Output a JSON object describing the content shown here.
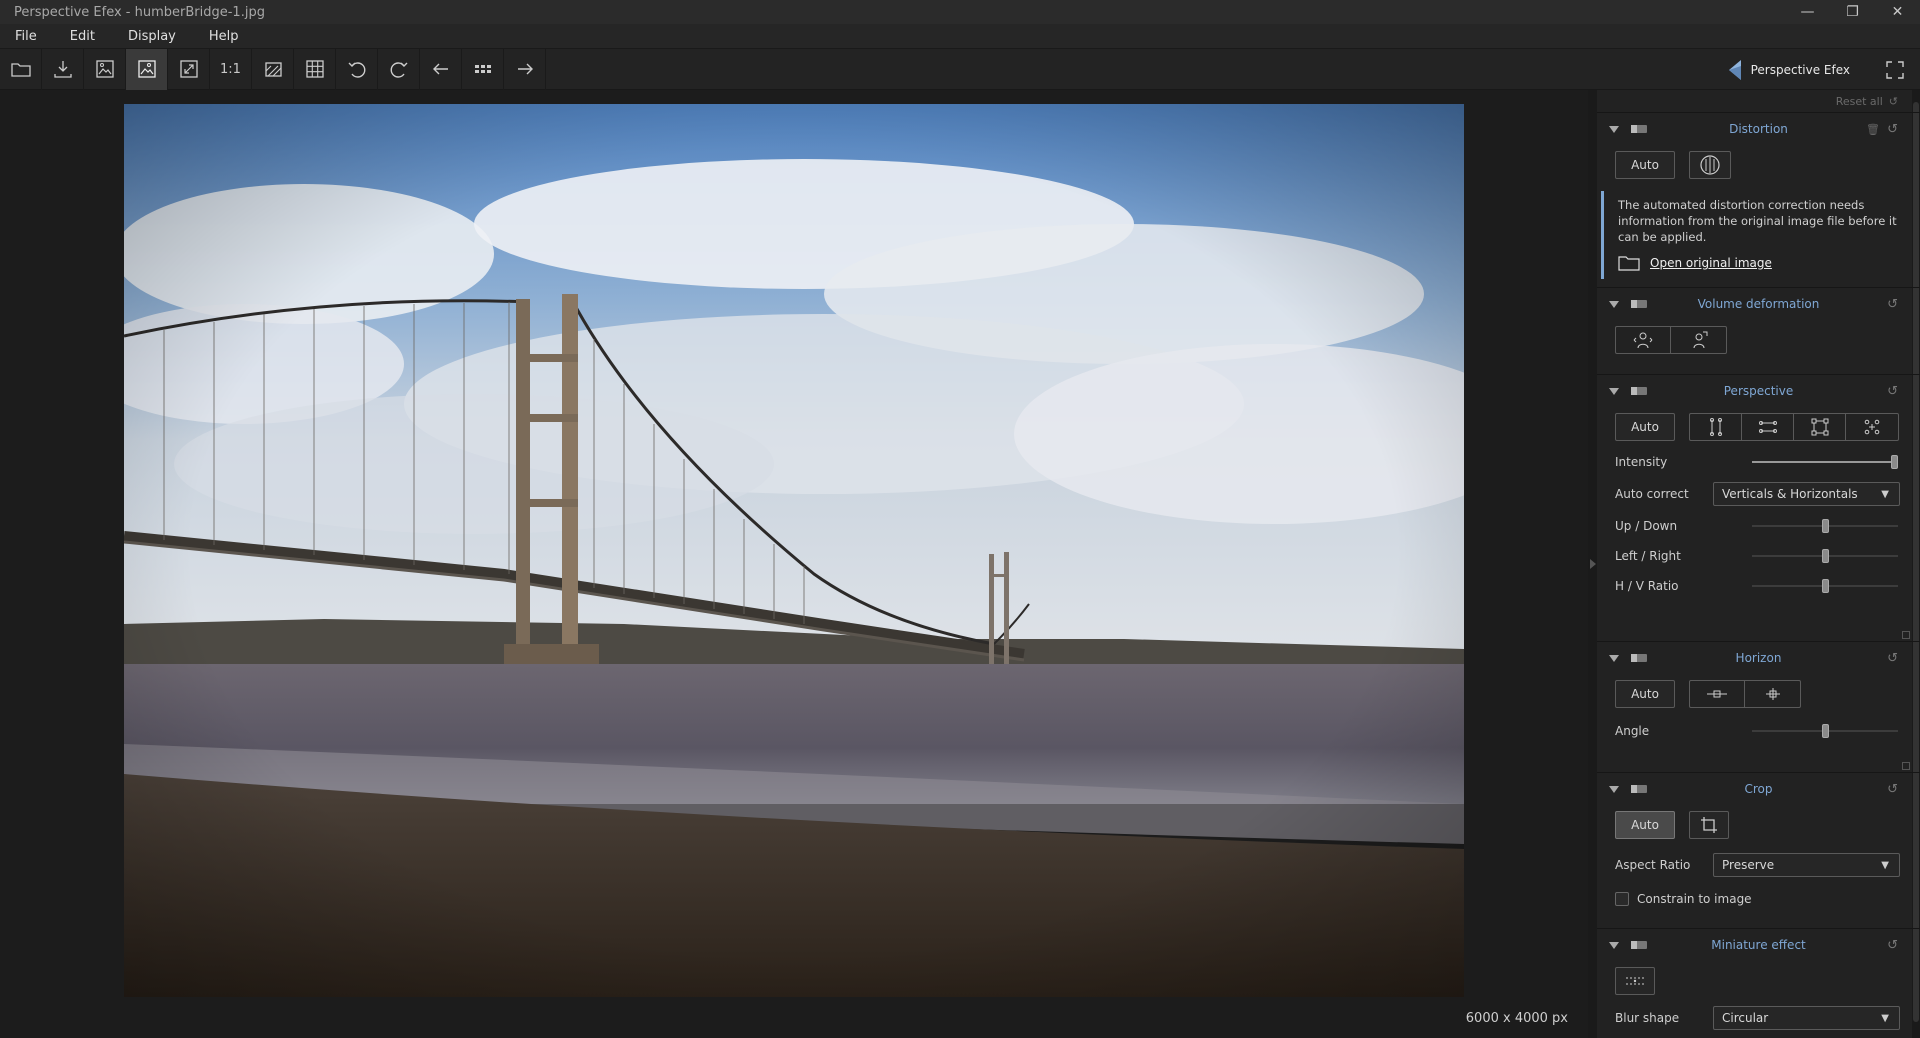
{
  "window": {
    "title": "Perspective Efex - humberBridge-1.jpg",
    "minimize": "—",
    "maximize": "❐",
    "close": "✕"
  },
  "menu": [
    "File",
    "Edit",
    "Display",
    "Help"
  ],
  "toolbar": {
    "zoom_1to1": "1:1",
    "brand": "Perspective Efex"
  },
  "canvas": {
    "image_dims": "6000 x 4000 px"
  },
  "panel": {
    "reset_all": "Reset all",
    "distortion": {
      "title": "Distortion",
      "auto": "Auto",
      "info": "The automated distortion correction needs information from the original image file before it can be applied.",
      "open_link": "Open original image"
    },
    "volume": {
      "title": "Volume deformation"
    },
    "perspective": {
      "title": "Perspective",
      "auto": "Auto",
      "intensity_label": "Intensity",
      "intensity_value": 1.0,
      "auto_correct_label": "Auto correct",
      "auto_correct_value": "Verticals & Horizontals",
      "updown_label": "Up / Down",
      "updown_value": 0.5,
      "leftright_label": "Left / Right",
      "leftright_value": 0.5,
      "hv_label": "H / V Ratio",
      "hv_value": 0.5
    },
    "horizon": {
      "title": "Horizon",
      "auto": "Auto",
      "angle_label": "Angle",
      "angle_value": 0.5
    },
    "crop": {
      "title": "Crop",
      "auto": "Auto",
      "aspect_label": "Aspect Ratio",
      "aspect_value": "Preserve",
      "constrain_label": "Constrain to image"
    },
    "miniature": {
      "title": "Miniature effect",
      "blur_label": "Blur shape",
      "blur_value": "Circular"
    }
  },
  "colors": {
    "accent": "#7fa7d4",
    "background": "#1e1e1e",
    "panel": "#222222"
  }
}
